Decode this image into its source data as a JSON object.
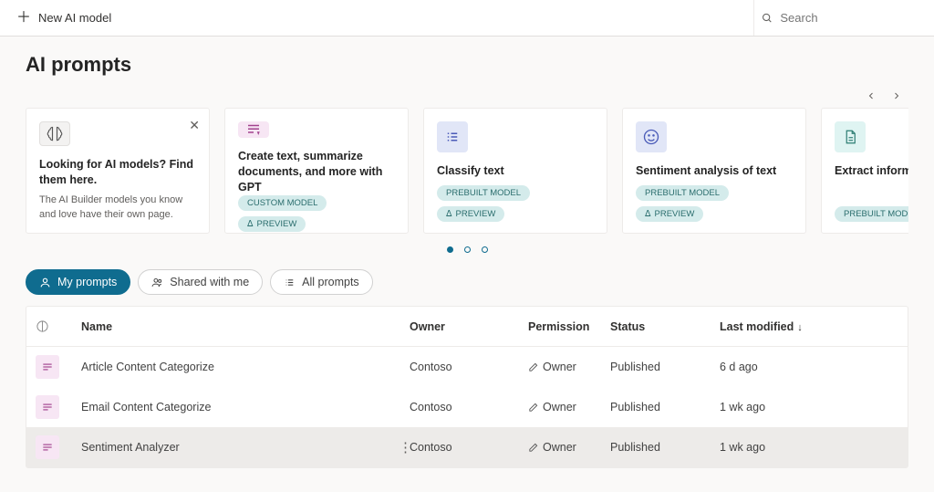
{
  "topbar": {
    "new_label": "New AI model",
    "search_placeholder": "Search"
  },
  "page_title": "AI prompts",
  "cards": [
    {
      "title": "Looking for AI models? Find them here.",
      "subtitle": "The AI Builder models you know and love have their own page.",
      "icon": "brain-icon",
      "icon_bg": "icon-gray",
      "closable": true,
      "badges": []
    },
    {
      "title": "Create text, summarize documents, and more with GPT",
      "icon": "text-spark-icon",
      "icon_bg": "icon-pink",
      "badges": [
        "CUSTOM MODEL",
        "PREVIEW"
      ]
    },
    {
      "title": "Classify text",
      "icon": "list-icon",
      "icon_bg": "icon-blue",
      "badges": [
        "PREBUILT MODEL",
        "PREVIEW"
      ]
    },
    {
      "title": "Sentiment analysis of text",
      "icon": "smile-icon",
      "icon_bg": "icon-blue",
      "badges": [
        "PREBUILT MODEL",
        "PREVIEW"
      ]
    },
    {
      "title": "Extract information",
      "icon": "document-icon",
      "icon_bg": "icon-teal",
      "badges": [
        "PREBUILT MODEL"
      ]
    }
  ],
  "pagination": {
    "count": 3,
    "active": 0
  },
  "filters": [
    {
      "icon": "person-icon",
      "label": "My prompts",
      "active": true
    },
    {
      "icon": "people-icon",
      "label": "Shared with me",
      "active": false
    },
    {
      "icon": "list-icon",
      "label": "All prompts",
      "active": false
    }
  ],
  "table": {
    "columns": {
      "name": "Name",
      "owner": "Owner",
      "permission": "Permission",
      "status": "Status",
      "modified": "Last modified"
    },
    "rows": [
      {
        "name": "Article Content Categorize",
        "owner": "Contoso",
        "permission": "Owner",
        "status": "Published",
        "modified": "6 d ago"
      },
      {
        "name": "Email Content Categorize",
        "owner": "Contoso",
        "permission": "Owner",
        "status": "Published",
        "modified": "1 wk ago"
      },
      {
        "name": "Sentiment Analyzer",
        "owner": "Contoso",
        "permission": "Owner",
        "status": "Published",
        "modified": "1 wk ago",
        "hover": true
      }
    ]
  }
}
